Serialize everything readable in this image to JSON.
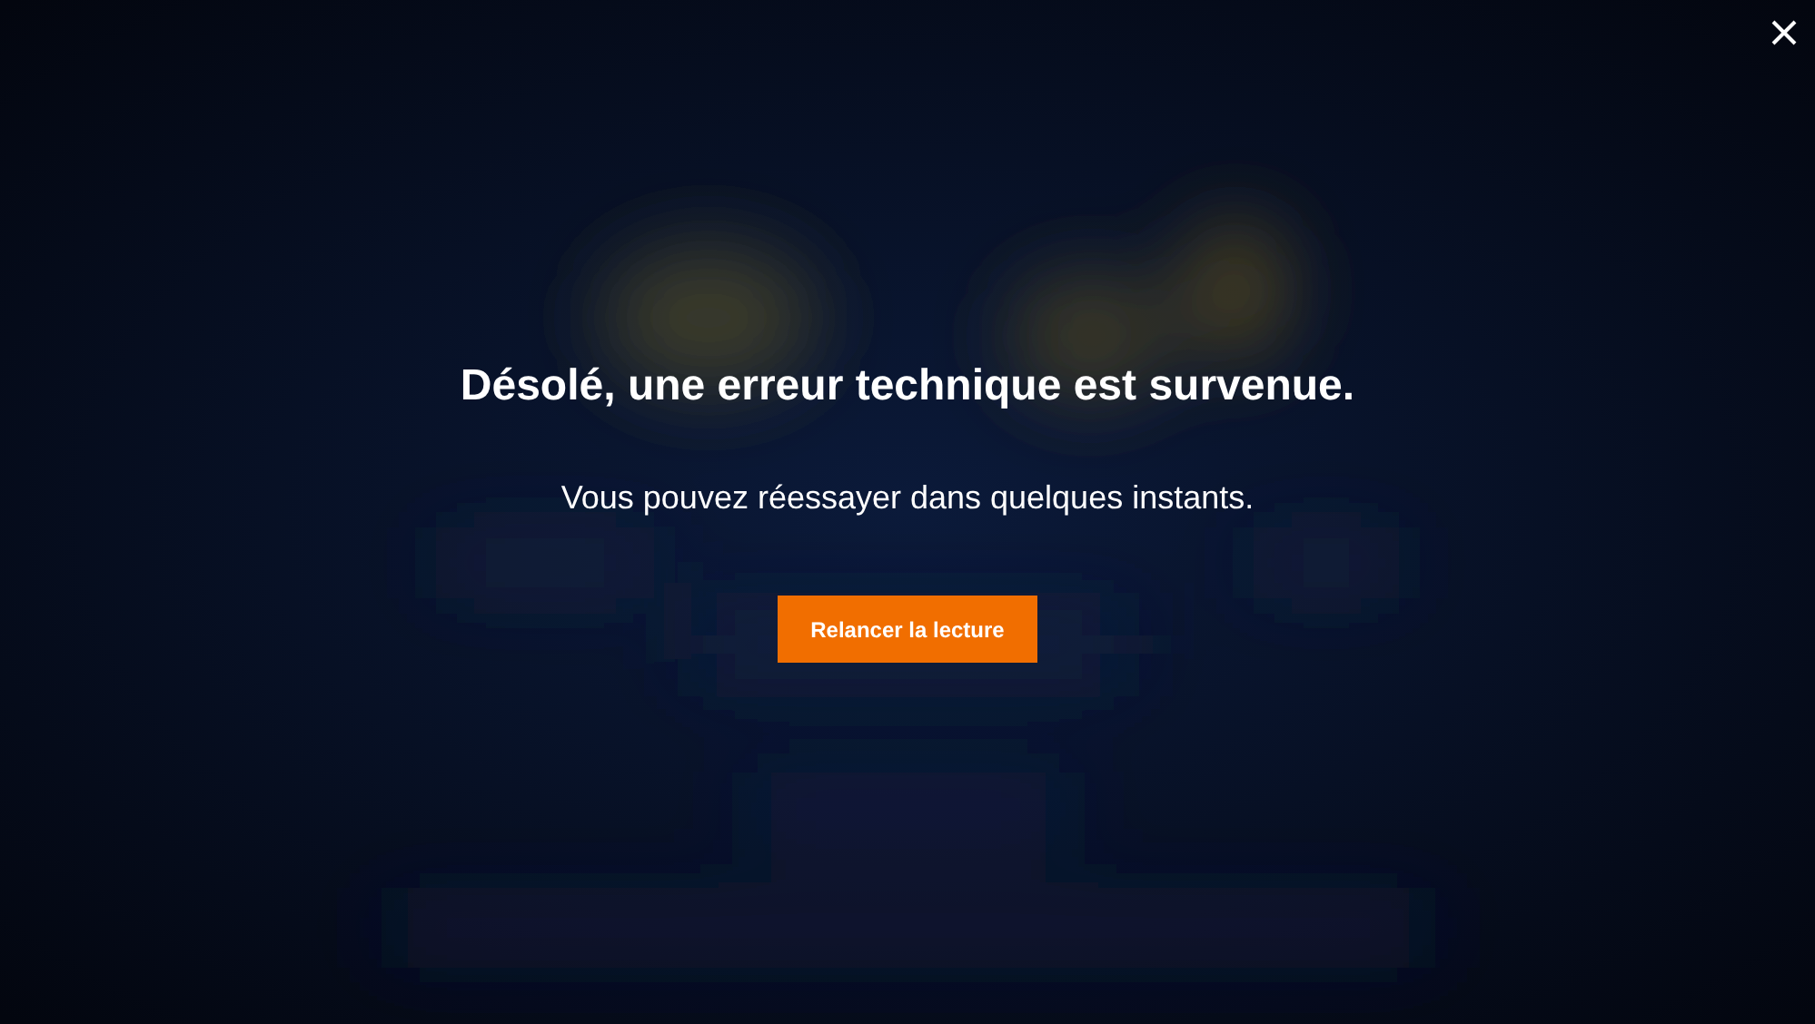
{
  "error": {
    "title": "Désolé, une erreur technique est survenue.",
    "message": "Vous pouvez réessayer dans quelques instants.",
    "button": "Relancer la lecture"
  }
}
